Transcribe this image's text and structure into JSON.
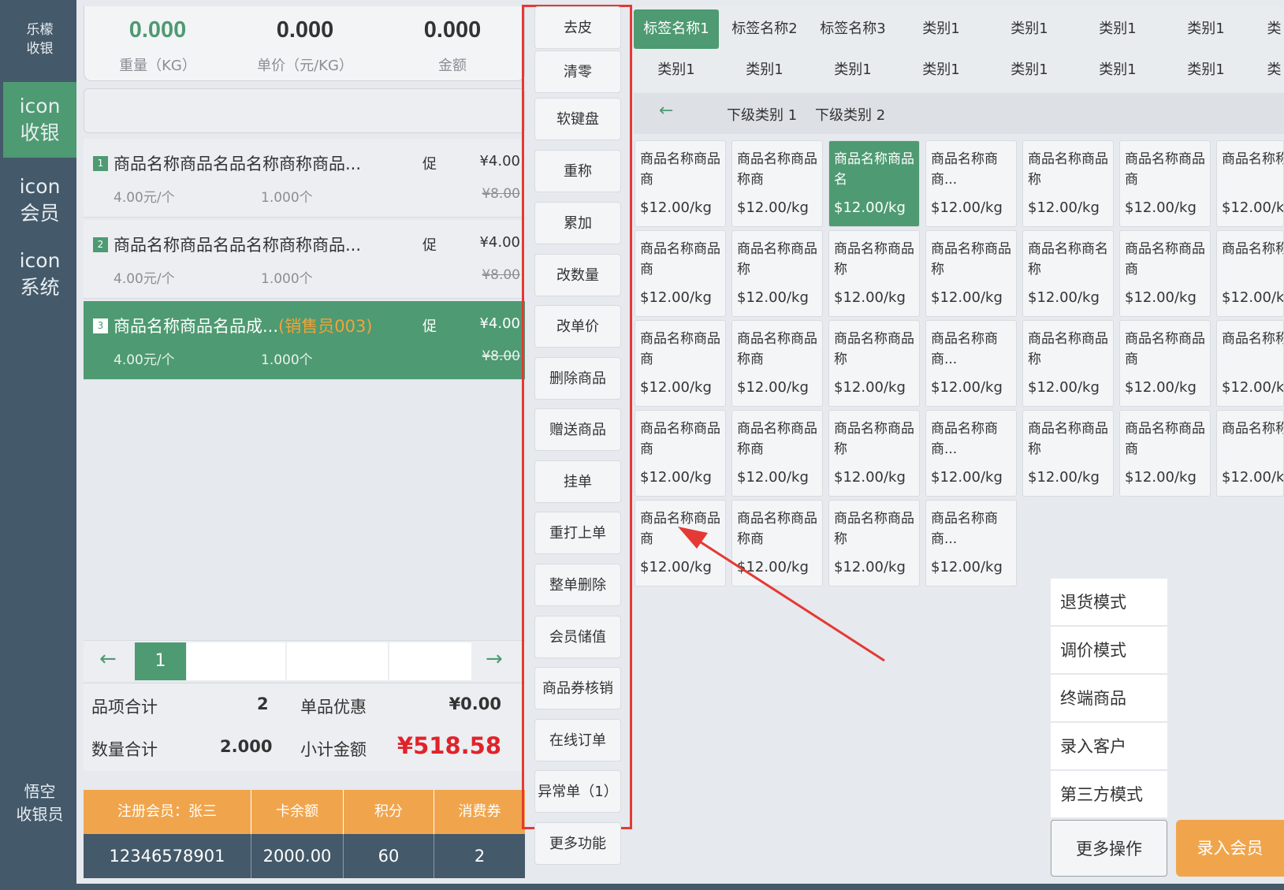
{
  "sidebar": {
    "brand": [
      "乐檬",
      "收银"
    ],
    "items": [
      {
        "icon": "icon",
        "label": "收银"
      },
      {
        "icon": "icon",
        "label": "会员"
      },
      {
        "icon": "icon",
        "label": "系统"
      }
    ],
    "user": [
      "悟空",
      "收银员"
    ]
  },
  "scale": {
    "weight": "0.000",
    "weight_label": "重量（KG）",
    "unit_price": "0.000",
    "unit_price_label": "单价（元/KG）",
    "amount": "0.000",
    "amount_label": "金额"
  },
  "order_items": [
    {
      "index": "1",
      "name": "商品名称商品名品名称商称商品...",
      "seller": "",
      "promo": "促",
      "price": "¥4.00",
      "unit_price": "4.00元/个",
      "qty": "1.000个",
      "original": "¥8.00"
    },
    {
      "index": "2",
      "name": "商品名称商品名品名称商称商品...",
      "seller": "",
      "promo": "促",
      "price": "¥4.00",
      "unit_price": "4.00元/个",
      "qty": "1.000个",
      "original": "¥8.00"
    },
    {
      "index": "3",
      "name": "商品名称商品名品成...",
      "seller": "(销售员003)",
      "promo": "促",
      "price": "¥4.00",
      "unit_price": "4.00元/个",
      "qty": "1.000个",
      "original": "¥8.00"
    }
  ],
  "pager": {
    "current": "1",
    "prev": "←",
    "next": "→"
  },
  "totals": {
    "items_label": "品项合计",
    "items_value": "2",
    "discount_label": "单品优惠",
    "discount_value": "¥0.00",
    "qty_label": "数量合计",
    "qty_value": "2.000",
    "subtotal_label": "小计金额",
    "subtotal_value": "¥518.58"
  },
  "member": {
    "headers": [
      "注册会员：张三",
      "卡余额",
      "积分",
      "消费券"
    ],
    "values": [
      "12346578901",
      "2000.00",
      "60",
      "2"
    ]
  },
  "functions": [
    "去皮",
    "清零",
    "软键盘",
    "重称",
    "累加",
    "改数量",
    "改单价",
    "删除商品",
    "赠送商品",
    "挂单",
    "重打上单",
    "整单删除",
    "会员储值",
    "商品券核销",
    "在线订单",
    "异常单（1）",
    "更多功能"
  ],
  "tabs_row1": [
    "标签名称1",
    "标签名称2",
    "标签名称3",
    "类别1",
    "类别1",
    "类别1",
    "类别1",
    "类"
  ],
  "tabs_row2": [
    "类别1",
    "类别1",
    "类别1",
    "类别1",
    "类别1",
    "类别1",
    "类别1",
    "类"
  ],
  "subcategory": {
    "back": "←",
    "items": [
      "下级类别 1",
      "下级类别 2"
    ]
  },
  "products": [
    [
      "商品名称商品商",
      "商品名称商品称商",
      "商品名称商品名",
      "商品名称商商...",
      "商品名称商品称",
      "商品名称商品商",
      "商品名称称"
    ],
    [
      "商品名称商品商",
      "商品名称商品称",
      "商品名称商品称",
      "商品名称商品称",
      "商品名称商名称",
      "商品名称商品商",
      "商品名称称"
    ],
    [
      "商品名称商品商",
      "商品名称商品称商",
      "商品名称商品称",
      "商品名称商商...",
      "商品名称商品称",
      "商品名称商品商",
      "商品名称称"
    ],
    [
      "商品名称商品商",
      "商品名称商品称商",
      "商品名称商品称",
      "商品名称商商...",
      "商品名称商品称",
      "商品名称商品商",
      "商品名称称"
    ],
    [
      "商品名称商品商",
      "商品名称商品称商",
      "商品名称商品称",
      "商品名称商商..."
    ]
  ],
  "product_price": "$12.00/kg",
  "selected_product": "0-2",
  "more_menu": [
    "退货模式",
    "调价模式",
    "终端商品",
    "录入客户",
    "第三方模式"
  ],
  "more_button": "更多操作",
  "vip_button": "录入会员",
  "colors": {
    "accent": "#4e9a72",
    "sidebar": "#44596a",
    "orange": "#f0a54c",
    "highlight_frame": "#e53935",
    "subtotal": "#e0232a"
  }
}
